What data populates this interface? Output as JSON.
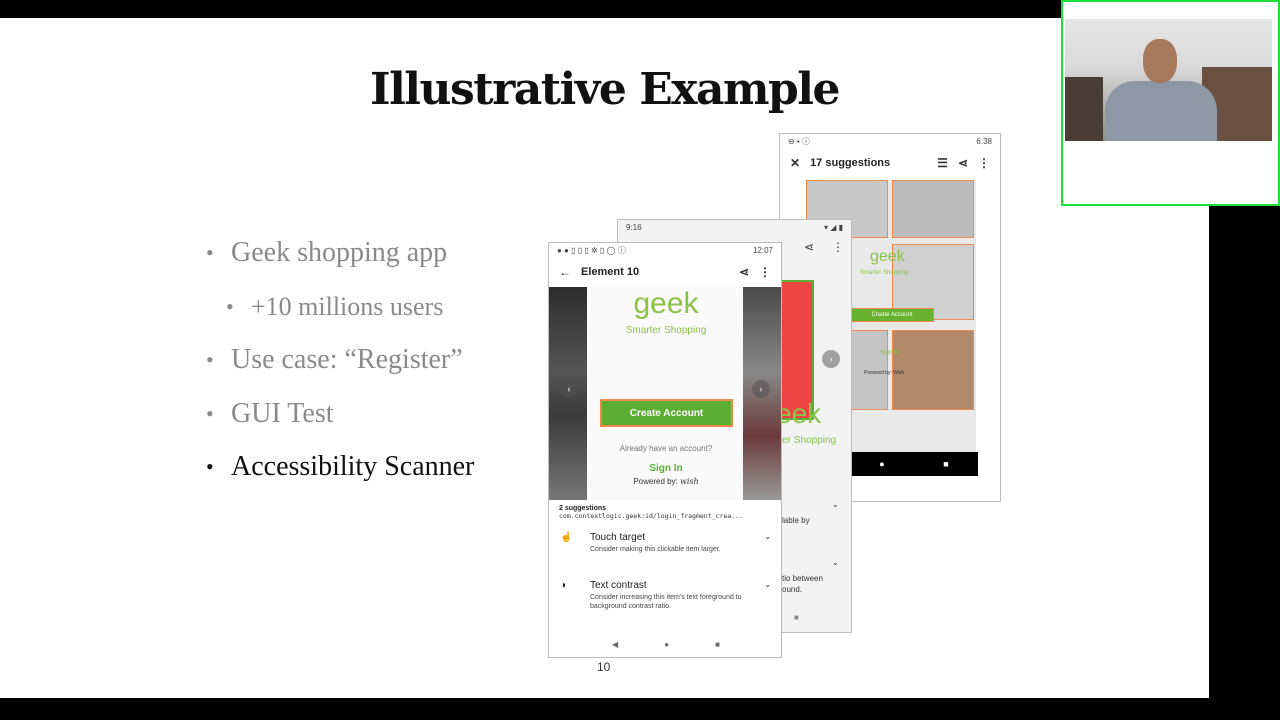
{
  "slide": {
    "title": "Illustrative Example",
    "page_number": "10",
    "bullets": [
      {
        "text": "Geek shopping app",
        "level": 1,
        "active": false
      },
      {
        "text": "+10 millions users",
        "level": 2,
        "active": false
      },
      {
        "text": "Use case: “Register”",
        "level": 1,
        "active": false
      },
      {
        "text": "GUI Test",
        "level": 1,
        "active": false
      },
      {
        "text": "Accessibility Scanner",
        "level": 1,
        "active": true
      }
    ]
  },
  "phone_back": {
    "time": "6:38",
    "title": "17 suggestions",
    "geek": "geek",
    "tagline": "Smarter Shopping",
    "create": "Create Account",
    "sign_in": "Sign In",
    "powered": "Powered by: Wish"
  },
  "phone_middle": {
    "time": "9:16",
    "geek_partial": "eek",
    "tag_partial": "rter Shopping",
    "text1": "lable by",
    "text2": "tio between",
    "text3": "ound."
  },
  "phone_front": {
    "time": "12:07",
    "title": "Element 10",
    "geek": "geek",
    "tagline": "Smarter Shopping",
    "create": "Create Account",
    "already": "Already have an account?",
    "sign_in": "Sign In",
    "powered_label": "Powered by:",
    "powered_brand": "wish",
    "suggestion_count": "2 suggestions",
    "element_id": "com.contextlogic.geek:id/login_fragment_crea...",
    "suggestions": [
      {
        "title": "Touch target",
        "desc": "Consider making this clickable item larger."
      },
      {
        "title": "Text contrast",
        "desc": "Consider increasing this item's text foreground to background contrast ratio."
      }
    ]
  },
  "icons": {
    "back": "arrow-left-icon",
    "close": "close-icon",
    "share": "share-icon",
    "more": "more-vert-icon",
    "list": "list-icon",
    "touch": "touch-icon",
    "contrast": "contrast-icon"
  }
}
